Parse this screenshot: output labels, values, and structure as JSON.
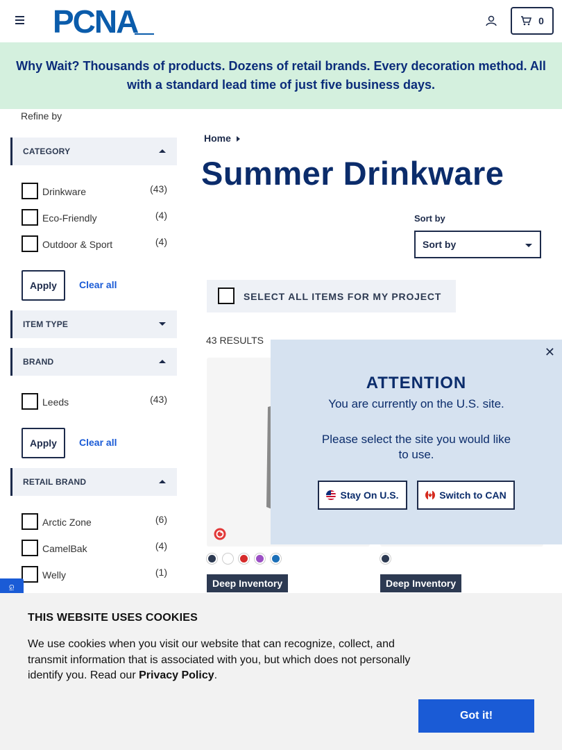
{
  "header": {
    "logo_text": "PCNA",
    "cart_count": "0"
  },
  "banner": {
    "text": "Why Wait? Thousands of products. Dozens of retail brands. Every decoration method. All with a standard lead time of just five business days."
  },
  "sidebar": {
    "refine_label": "Refine by",
    "category": {
      "title": "CATEGORY",
      "options": [
        {
          "label": "Drinkware",
          "count": "(43)"
        },
        {
          "label": "Eco-Friendly",
          "count": "(4)"
        },
        {
          "label": "Outdoor & Sport",
          "count": "(4)"
        }
      ],
      "apply": "Apply",
      "clear": "Clear all"
    },
    "item_type": {
      "title": "ITEM TYPE"
    },
    "brand": {
      "title": "BRAND",
      "options": [
        {
          "label": "Leeds",
          "count": "(43)"
        }
      ],
      "apply": "Apply",
      "clear": "Clear all"
    },
    "retail_brand": {
      "title": "RETAIL BRAND",
      "options": [
        {
          "label": "Arctic Zone",
          "count": "(6)"
        },
        {
          "label": "CamelBak",
          "count": "(4)"
        },
        {
          "label": "Welly",
          "count": "(1)"
        }
      ]
    }
  },
  "main": {
    "breadcrumb": "Home",
    "title": "Summer Drinkware",
    "sort_label": "Sort by",
    "sort_value": "Sort by",
    "select_all": "SELECT ALL ITEMS FOR MY PROJECT",
    "results": "43 RESULTS",
    "products": [
      {
        "badge": "Deep Inventory",
        "swatches": [
          "#2d3a52",
          "#ffffff",
          "#d62b2b",
          "#9b4fc4",
          "#1b6fb8"
        ]
      },
      {
        "badge": "Deep Inventory",
        "swatches": [
          "#2d3a52"
        ]
      }
    ]
  },
  "modal": {
    "title": "ATTENTION",
    "line1": "You are currently on the U.S. site.",
    "line2": "Please select the site you would like to use.",
    "stay": "Stay On U.S.",
    "switch": "Switch to CAN"
  },
  "side_tab": "Gi",
  "cookie": {
    "title": "THIS WEBSITE USES COOKIES",
    "text": "We use cookies when you visit our website that can recognize, collect, and transmit information that is associated with you, but which does not personally identify you. Read our ",
    "link": "Privacy Policy",
    "tail": ".",
    "button": "Got it!"
  }
}
